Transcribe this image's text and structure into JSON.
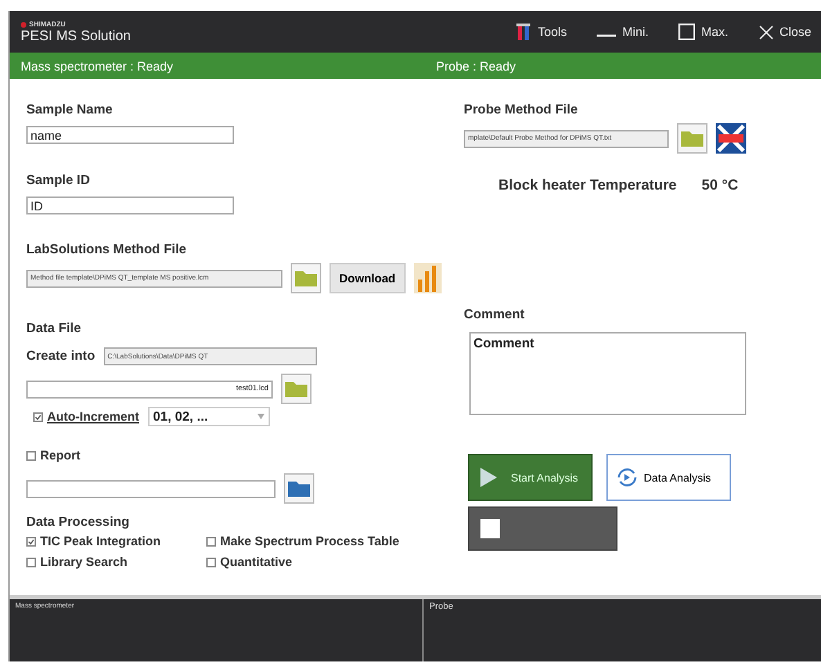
{
  "window": {
    "brand": "SHIMADZU",
    "title": "PESI MS Solution",
    "controls": [
      {
        "kind": "tools",
        "label": "Tools"
      },
      {
        "kind": "min",
        "label": "Mini."
      },
      {
        "kind": "max",
        "label": "Max."
      },
      {
        "kind": "close",
        "label": "Close"
      }
    ]
  },
  "status_bar": {
    "left": "Mass spectrometer  :  Ready",
    "right": "Probe  :  Ready"
  },
  "sample_name": {
    "label": "Sample Name",
    "value": "name"
  },
  "sample_id": {
    "label": "Sample ID",
    "value": "ID"
  },
  "labsolutions_method": {
    "label": "LabSolutions Method File",
    "value": "Method file template\\DPiMS QT_template MS positive.lcm",
    "download": "Download"
  },
  "data_file": {
    "label": "Data File",
    "create_into_label": "Create into",
    "create_into": "C:\\LabSolutions\\Data\\DPiMS QT",
    "file_name": "test01.lcd",
    "auto_increment": {
      "label": "Auto-Increment",
      "checked": true,
      "format": "01, 02, ..."
    }
  },
  "report": {
    "label": "Report",
    "checked": false
  },
  "data_processing": {
    "label": "Data Processing",
    "options": [
      {
        "label": "TIC Peak Integration",
        "checked": true
      },
      {
        "label": "Make Spectrum Process Table",
        "checked": false
      },
      {
        "label": "Library Search",
        "checked": false
      },
      {
        "label": "Quantitative",
        "checked": false
      }
    ]
  },
  "probe_method": {
    "label": "Probe Method File",
    "value": "mplate\\Default Probe Method for DPiMS QT.txt"
  },
  "block_heater": {
    "label": "Block heater Temperature",
    "value": "50 °C"
  },
  "comment": {
    "label": "Comment",
    "value": "Comment"
  },
  "actions": {
    "start": "Start Analysis",
    "data_analysis": "Data Analysis"
  },
  "monitors": [
    {
      "title": "Mass spectrometer"
    },
    {
      "title": "Probe"
    }
  ]
}
